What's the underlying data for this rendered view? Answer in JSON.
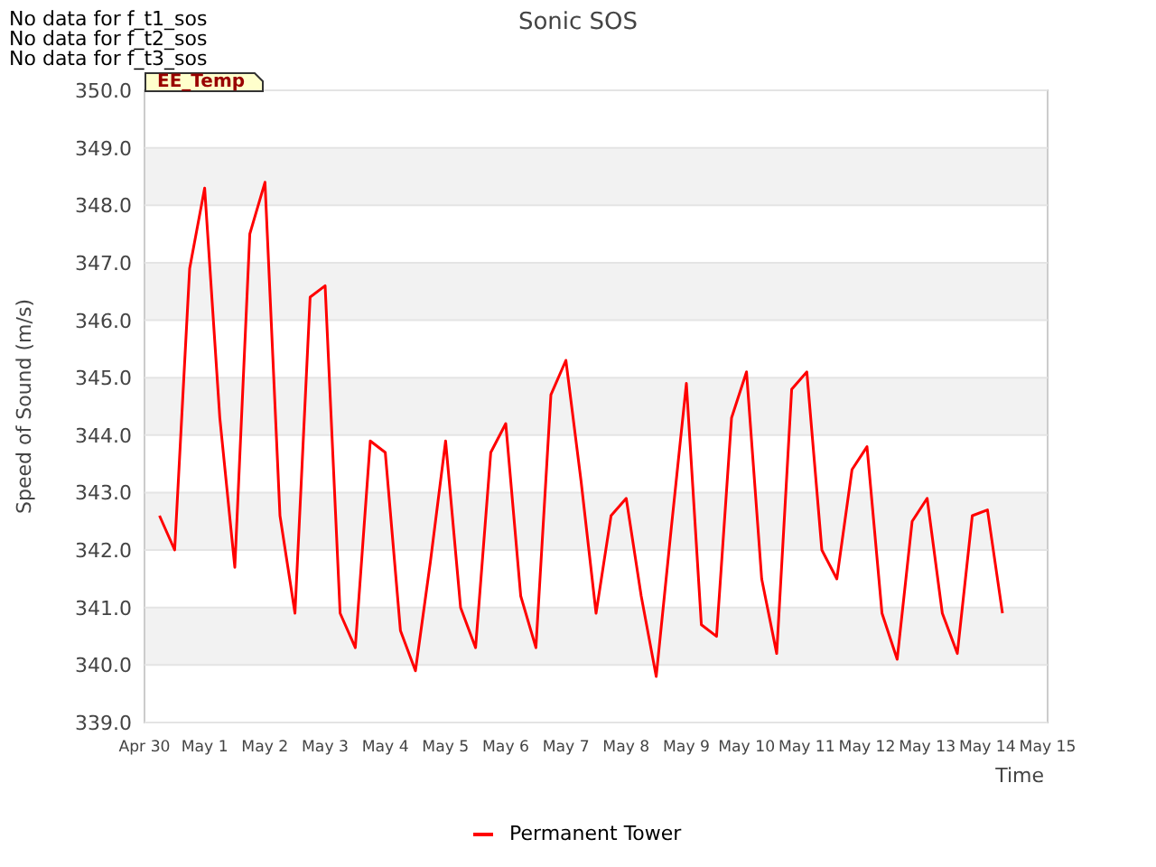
{
  "notices": [
    "No data for f_t1_sos",
    "No data for f_t2_sos",
    "No data for f_t3_sos"
  ],
  "tag_label": "EE_Temp",
  "chart_data": {
    "type": "line",
    "title": "Sonic SOS",
    "xlabel": "Time",
    "ylabel": "Speed of Sound (m/s)",
    "categories": [
      "Apr 30",
      null,
      null,
      null,
      "May 1",
      null,
      null,
      null,
      "May 2",
      null,
      null,
      null,
      "May 3",
      null,
      null,
      null,
      "May 4",
      null,
      null,
      null,
      "May 5",
      null,
      null,
      null,
      "May 6",
      null,
      null,
      null,
      "May 7",
      null,
      null,
      null,
      "May 8",
      null,
      null,
      null,
      "May 9",
      null,
      null,
      null,
      "May 10",
      null,
      null,
      null,
      "May 11",
      null,
      null,
      null,
      "May 12",
      null,
      null,
      null,
      "May 13",
      null,
      null,
      null,
      "May 14",
      null,
      null,
      null,
      "May 15"
    ],
    "series": [
      {
        "name": "Permanent Tower",
        "color": "#ff0000",
        "values": [
          null,
          342.6,
          342.0,
          346.9,
          348.3,
          344.3,
          341.7,
          347.5,
          348.4,
          342.6,
          340.9,
          346.4,
          346.6,
          340.9,
          340.3,
          343.9,
          343.7,
          340.6,
          339.9,
          341.8,
          343.9,
          341.0,
          340.3,
          343.7,
          344.2,
          341.2,
          340.3,
          344.7,
          345.3,
          343.2,
          340.9,
          342.6,
          342.9,
          341.2,
          339.8,
          342.4,
          344.9,
          340.7,
          340.5,
          344.3,
          345.1,
          341.5,
          340.2,
          344.8,
          345.1,
          342.0,
          341.5,
          343.4,
          343.8,
          340.9,
          340.1,
          342.5,
          342.9,
          340.9,
          340.2,
          342.6,
          342.7,
          340.9,
          null,
          null,
          null
        ]
      }
    ],
    "grid": true,
    "ylim": [
      339,
      350
    ],
    "yticks": [
      {
        "value": 339,
        "label": "339.0"
      },
      {
        "value": 340,
        "label": "340.0"
      },
      {
        "value": 341,
        "label": "341.0"
      },
      {
        "value": 342,
        "label": "342.0"
      },
      {
        "value": 343,
        "label": "343.0"
      },
      {
        "value": 344,
        "label": "344.0"
      },
      {
        "value": 345,
        "label": "345.0"
      },
      {
        "value": 346,
        "label": "346.0"
      },
      {
        "value": 347,
        "label": "347.0"
      },
      {
        "value": 348,
        "label": "348.0"
      },
      {
        "value": 349,
        "label": "349.0"
      },
      {
        "value": 350,
        "label": "350.0"
      }
    ]
  }
}
